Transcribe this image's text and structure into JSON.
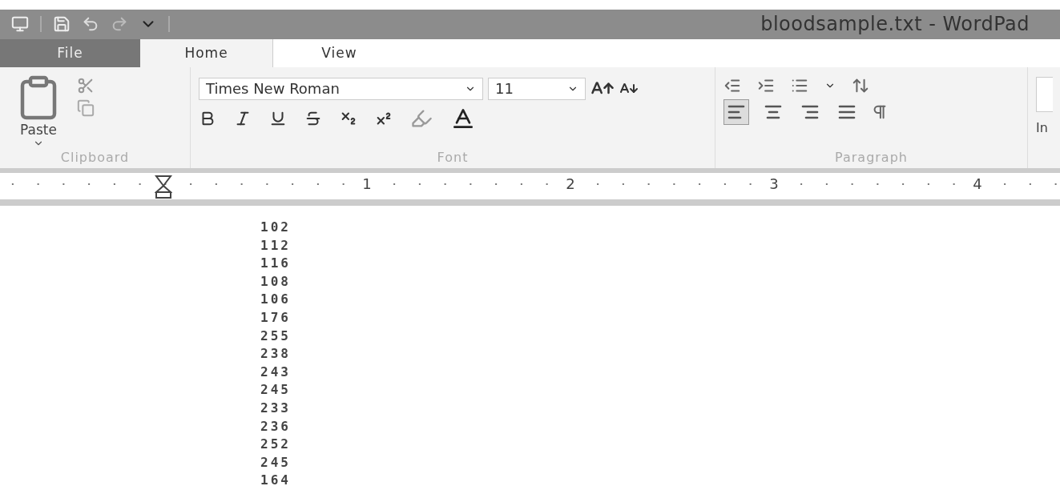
{
  "window": {
    "title": "bloodsample.txt - WordPad"
  },
  "tabs": [
    {
      "label": "File",
      "kind": "file",
      "selected": false
    },
    {
      "label": "Home",
      "kind": "tab",
      "selected": true
    },
    {
      "label": "View",
      "kind": "tab",
      "selected": false
    }
  ],
  "ribbon": {
    "clipboard": {
      "paste_label": "Paste",
      "group_label": "Clipboard"
    },
    "font": {
      "font_name": "Times New Roman",
      "font_size": "11",
      "group_label": "Font"
    },
    "paragraph": {
      "group_label": "Paragraph",
      "alignments": [
        {
          "kind": "left",
          "selected": true
        },
        {
          "kind": "center",
          "selected": false
        },
        {
          "kind": "right",
          "selected": false
        },
        {
          "kind": "justify",
          "selected": false
        }
      ]
    },
    "next_group_label": "In"
  },
  "ruler": {
    "marks": [
      "1",
      "2",
      "3",
      "4"
    ]
  },
  "document": {
    "lines": [
      "102",
      "112",
      "116",
      "108",
      "106",
      "176",
      "255",
      "238",
      "243",
      "245",
      "233",
      "236",
      "252",
      "245",
      "164"
    ]
  }
}
